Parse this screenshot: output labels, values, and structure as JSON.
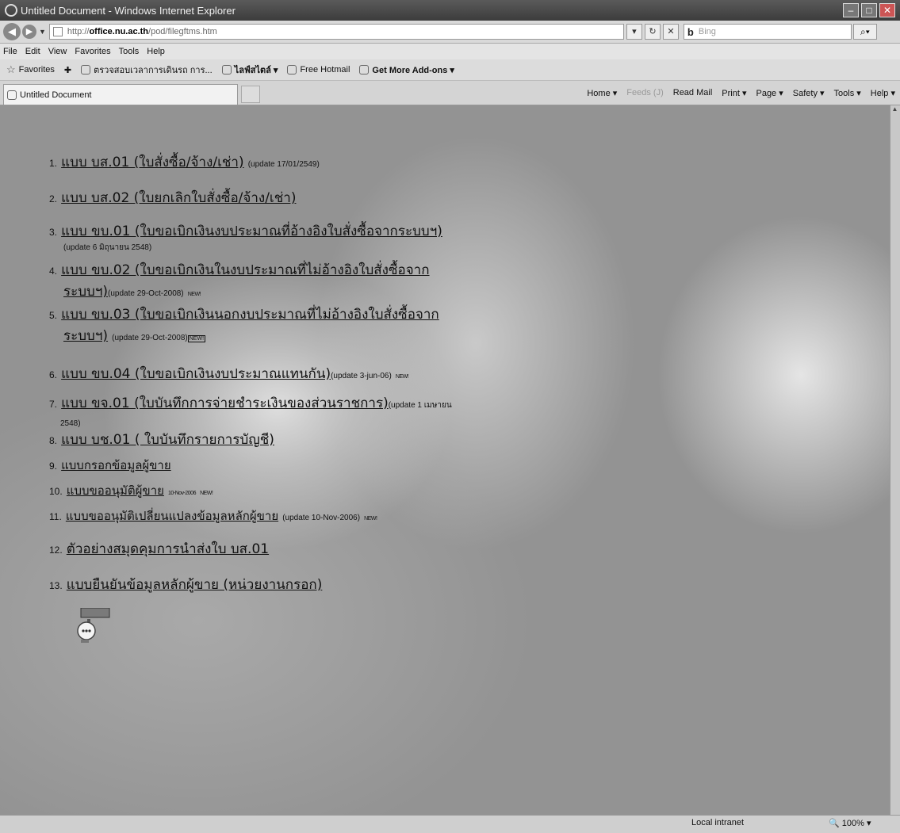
{
  "window": {
    "title": "Untitled Document - Windows Internet Explorer"
  },
  "address": {
    "url_prefix": "http://",
    "url_host": "office.nu.ac.th",
    "url_path": "/pod/filegftms.htm"
  },
  "search": {
    "placeholder": "Bing",
    "engine": "b"
  },
  "menu": [
    "File",
    "Edit",
    "View",
    "Favorites",
    "Tools",
    "Help"
  ],
  "favorites": {
    "label": "Favorites",
    "items": [
      "ตรวจสอบเวลาการเดินรถ การ...",
      "ไลฟ์สไตล์ ▾",
      "Free Hotmail",
      "Get More Add-ons ▾"
    ]
  },
  "tab": {
    "label": "Untitled Document"
  },
  "commands": [
    "Home ▾",
    "Feeds (J)",
    "Read Mail",
    "Print ▾",
    "Page ▾",
    "Safety ▾",
    "Tools ▾",
    "Help ▾"
  ],
  "forms": [
    {
      "num": "1.",
      "title": "แบบ บส.01 (ใบสั่งซื้อ/จ้าง/เช่า)",
      "note": "(update 17/01/2549)"
    },
    {
      "num": "2.",
      "title": "แบบ บส.02 (ใบยกเลิกใบสั่งซื้อ/จ้าง/เช่า)"
    },
    {
      "num": "3.",
      "title": "แบบ ขบ.01 (ใบขอเบิกเงินงบประมาณที่อ้างอิงใบสั่งซื้อจากระบบฯ)",
      "note": "(update 6 มิถุนายน 2548)"
    },
    {
      "num": "4.",
      "title_line1": "แบบ ขบ.02 (ใบขอเบิกเงินในงบประมาณที่ไม่อ้างอิงใบสั่งซื้อจาก",
      "title_line2": "ระบบฯ)",
      "note": "(update 29-Oct-2008)",
      "badge": "NEW!"
    },
    {
      "num": "5.",
      "title_line1": "แบบ ขบ.03 (ใบขอเบิกเงินนอกงบประมาณที่ไม่อ้างอิงใบสั่งซื้อจาก",
      "title_line2": "ระบบฯ)",
      "note": "(update 29-Oct-2008)",
      "badge": "NEW!"
    },
    {
      "num": "6.",
      "title": "แบบ ขบ.04 (ใบขอเบิกเงินงบประมาณแทนกัน)",
      "note": "(update 3-jun-06)",
      "badge": "NEW!"
    },
    {
      "num": "7.",
      "title": "แบบ ขจ.01 (ใบบันทึกการจ่ายชำระเงินของส่วนราชการ)",
      "note": "(update 1 เมษายน",
      "note2": "2548)"
    },
    {
      "num": "8.",
      "title": "แบบ บช.01 ( ใบบันทึกรายการบัญชี)"
    },
    {
      "num": "9.",
      "title": "แบบกรอกข้อมูลผู้ขาย"
    },
    {
      "num": "10.",
      "title": "แบบขออนุมัติผู้ขาย",
      "note": "10-Nov-2006",
      "badge": "NEW!"
    },
    {
      "num": "11.",
      "title": "แบบขออนุมัติเปลี่ยนแปลงข้อมูลหลักผู้ขาย",
      "note": "(update 10-Nov-2006)",
      "badge": "NEW!"
    },
    {
      "num": "12.",
      "title": "ตัวอย่างสมุดคุมการนำส่งใบ บส.01"
    },
    {
      "num": "13.",
      "title": "แบบยืนยันข้อมูลหลักผู้ขาย (หน่วยงานกรอก)"
    }
  ],
  "status": {
    "zone": "Local intranet",
    "zoom": "100%"
  }
}
